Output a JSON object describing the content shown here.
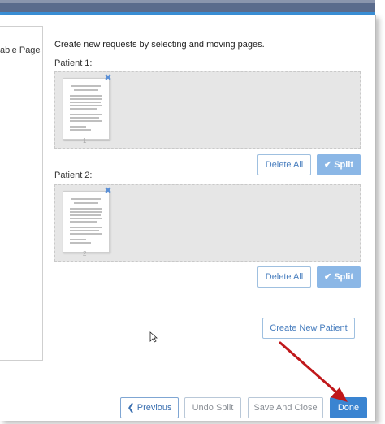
{
  "left_panel": {
    "title": "able Pages"
  },
  "instructions": "Create new requests by selecting and moving pages.",
  "patients": [
    {
      "label": "Patient 1:",
      "page_number": "1",
      "delete_label": "Delete All",
      "split_label": "Split"
    },
    {
      "label": "Patient 2:",
      "page_number": "2",
      "delete_label": "Delete All",
      "split_label": "Split"
    }
  ],
  "remove_glyph": "✖",
  "split_glyph": "✔",
  "create_new_patient": "Create New Patient",
  "footer": {
    "previous_glyph": "❮",
    "previous": "Previous",
    "undo_split": "Undo Split",
    "save_and_close": "Save And Close",
    "done": "Done"
  },
  "colors": {
    "accent": "#3a84d1",
    "split_disabled": "#8bb7e6",
    "annotation_arrow": "#c0181b"
  }
}
